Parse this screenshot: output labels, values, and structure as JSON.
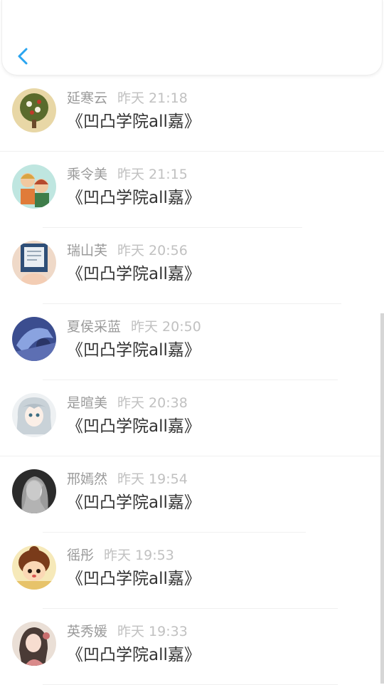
{
  "header": {
    "back_icon": "chevron-left-icon",
    "accent": "#2aa5f0"
  },
  "comments": [
    {
      "name": "延寒云",
      "time": "昨天 21:18",
      "text": "《凹凸学院all嘉》"
    },
    {
      "name": "乘令美",
      "time": "昨天 21:15",
      "text": "《凹凸学院all嘉》"
    },
    {
      "name": "瑞山芙",
      "time": "昨天 20:56",
      "text": "《凹凸学院all嘉》"
    },
    {
      "name": "夏侯采蓝",
      "time": "昨天 20:50",
      "text": "《凹凸学院all嘉》"
    },
    {
      "name": "是暄美",
      "time": "昨天 20:38",
      "text": "《凹凸学院all嘉》"
    },
    {
      "name": "邢嫣然",
      "time": "昨天 19:54",
      "text": "《凹凸学院all嘉》"
    },
    {
      "name": "徭彤",
      "time": "昨天 19:53",
      "text": "《凹凸学院all嘉》"
    },
    {
      "name": "英秀媛",
      "time": "昨天 19:33",
      "text": "《凹凸学院all嘉》"
    }
  ]
}
